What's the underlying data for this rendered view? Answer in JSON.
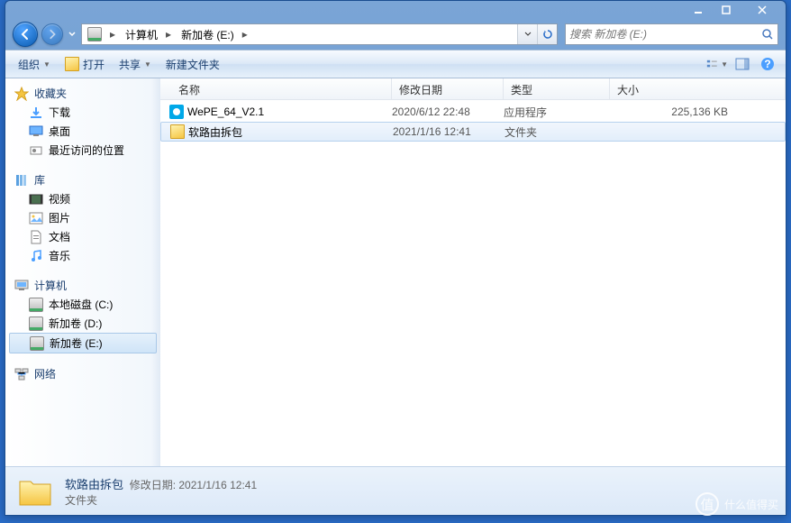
{
  "breadcrumb": {
    "root": "计算机",
    "drive": "新加卷 (E:)"
  },
  "search": {
    "placeholder": "搜索 新加卷 (E:)"
  },
  "toolbar": {
    "organize": "组织",
    "open": "打开",
    "share": "共享",
    "newfolder": "新建文件夹"
  },
  "columns": {
    "name": "名称",
    "date": "修改日期",
    "type": "类型",
    "size": "大小"
  },
  "files": [
    {
      "name": "WePE_64_V2.1",
      "date": "2020/6/12 22:48",
      "type": "应用程序",
      "size": "225,136 KB"
    },
    {
      "name": "软路由拆包",
      "date": "2021/1/16 12:41",
      "type": "文件夹",
      "size": ""
    }
  ],
  "sidebar": {
    "favorites": {
      "title": "收藏夹",
      "items": [
        "下载",
        "桌面",
        "最近访问的位置"
      ]
    },
    "libraries": {
      "title": "库",
      "items": [
        "视频",
        "图片",
        "文档",
        "音乐"
      ]
    },
    "computer": {
      "title": "计算机",
      "items": [
        "本地磁盘 (C:)",
        "新加卷 (D:)",
        "新加卷 (E:)"
      ]
    },
    "network": {
      "title": "网络"
    }
  },
  "details": {
    "name": "软路由拆包",
    "date_label": "修改日期:",
    "date": "2021/1/16 12:41",
    "type": "文件夹"
  },
  "watermark": {
    "text": "什么值得买",
    "badge": "值"
  }
}
